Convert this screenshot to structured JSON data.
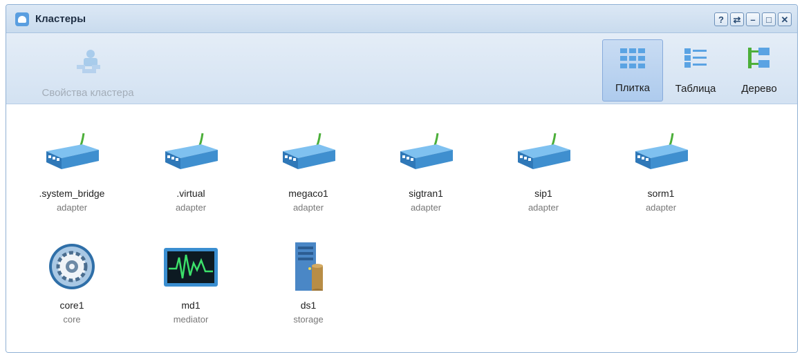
{
  "window": {
    "title": "Кластеры",
    "buttons": [
      {
        "name": "help-button",
        "glyph": "?"
      },
      {
        "name": "refresh-button",
        "glyph": "⇄"
      },
      {
        "name": "minimize-button",
        "glyph": "–"
      },
      {
        "name": "maximize-button",
        "glyph": "□"
      },
      {
        "name": "close-button",
        "glyph": "✕"
      }
    ]
  },
  "toolbar": {
    "properties_label": "Свойства кластера",
    "views": [
      {
        "id": "tile",
        "label": "Плитка",
        "icon": "tile-view-icon",
        "active": true
      },
      {
        "id": "table",
        "label": "Таблица",
        "icon": "table-view-icon",
        "active": false
      },
      {
        "id": "tree",
        "label": "Дерево",
        "icon": "tree-view-icon",
        "active": false
      }
    ]
  },
  "tiles": [
    {
      "name": ".system_bridge",
      "type": "adapter",
      "icon": "adapter-icon"
    },
    {
      "name": ".virtual",
      "type": "adapter",
      "icon": "adapter-icon"
    },
    {
      "name": "megaco1",
      "type": "adapter",
      "icon": "adapter-icon"
    },
    {
      "name": "sigtran1",
      "type": "adapter",
      "icon": "adapter-icon"
    },
    {
      "name": "sip1",
      "type": "adapter",
      "icon": "adapter-icon"
    },
    {
      "name": "sorm1",
      "type": "adapter",
      "icon": "adapter-icon"
    },
    {
      "name": "core1",
      "type": "core",
      "icon": "core-gear-icon"
    },
    {
      "name": "md1",
      "type": "mediator",
      "icon": "mediator-monitor-icon"
    },
    {
      "name": "ds1",
      "type": "storage",
      "icon": "storage-server-icon"
    }
  ],
  "colors": {
    "titlebar": "#c9dbee",
    "toolbar": "#d3e2f2",
    "active_view": "#aecbed",
    "adapter_blue": "#3f8fcf",
    "cable_green": "#4caf3a"
  }
}
